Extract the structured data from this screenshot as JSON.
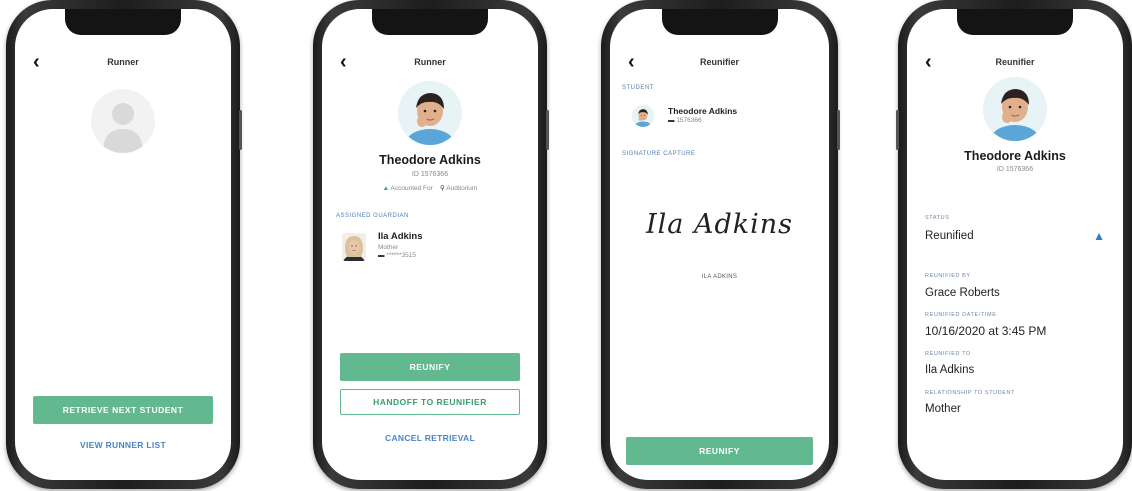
{
  "screen1": {
    "title": "Runner",
    "back_glyph": "‹",
    "avatar_icon": "placeholder-person-icon",
    "retrieve_next_label": "RETRIEVE NEXT STUDENT",
    "view_runner_list_label": "VIEW RUNNER LIST"
  },
  "screen2": {
    "title": "Runner",
    "back_glyph": "‹",
    "student_name": "Theodore Adkins",
    "student_id": "ID 1576366",
    "status_accounted": "Accounted For",
    "status_location": "Auditorium",
    "assigned_guardian_heading": "ASSIGNED GUARDIAN",
    "guardian_name": "Ila Adkins",
    "guardian_relation": "Mother",
    "guardian_phone": "******3515",
    "reunify_label": "REUNIFY",
    "handoff_label": "HANDOFF TO REUNIFIER",
    "cancel_label": "CANCEL RETRIEVAL"
  },
  "screen3": {
    "title": "Reunifier",
    "back_glyph": "‹",
    "student_heading": "STUDENT",
    "student_name": "Theodore Adkins",
    "student_id": "1576366",
    "signature_heading": "SIGNATURE CAPTURE",
    "signature_text": "Ila Adkins",
    "signer_name": "ILA ADKINS",
    "reunify_label": "REUNIFY"
  },
  "screen4": {
    "title": "Reunifier",
    "back_glyph": "‹",
    "student_name": "Theodore Adkins",
    "student_id": "ID 1576366",
    "status_label": "STATUS",
    "status_value": "Reunified",
    "reunified_by_label": "REUNIFIED BY",
    "reunified_by_value": "Grace Roberts",
    "datetime_label": "REUNIFIED DATE/TIME",
    "datetime_value": "10/16/2020 at 3:45 PM",
    "reunified_to_label": "REUNIFIED TO",
    "reunified_to_value": "Ila Adkins",
    "relationship_label": "RELATIONSHIP TO STUDENT",
    "relationship_value": "Mother"
  },
  "colors": {
    "accent_green": "#63b98f",
    "link_blue": "#4a84c8",
    "section_blue": "#4f7fb3",
    "status_blue": "#2f7dc6"
  }
}
